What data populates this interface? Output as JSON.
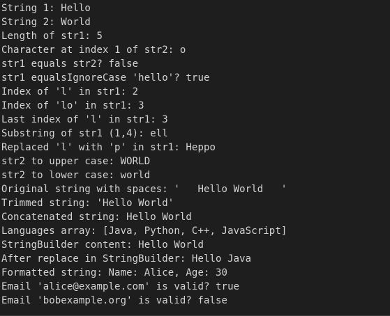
{
  "console": {
    "lines": [
      "String 1: Hello",
      "String 2: World",
      "Length of str1: 5",
      "Character at index 1 of str2: o",
      "str1 equals str2? false",
      "str1 equalsIgnoreCase 'hello'? true",
      "Index of 'l' in str1: 2",
      "Index of 'lo' in str1: 3",
      "Last index of 'l' in str1: 3",
      "Substring of str1 (1,4): ell",
      "Replaced 'l' with 'p' in str1: Heppo",
      "str2 to upper case: WORLD",
      "str2 to lower case: world",
      "Original string with spaces: '   Hello World   '",
      "Trimmed string: 'Hello World'",
      "Concatenated string: Hello World",
      "Languages array: [Java, Python, C++, JavaScript]",
      "StringBuilder content: Hello World",
      "After replace in StringBuilder: Hello Java",
      "Formatted string: Name: Alice, Age: 30",
      "Email 'alice@example.com' is valid? true",
      "Email 'bobexample.org' is valid? false"
    ]
  },
  "colors": {
    "background": "#1e1e1e",
    "text": "#d4d4d4"
  }
}
